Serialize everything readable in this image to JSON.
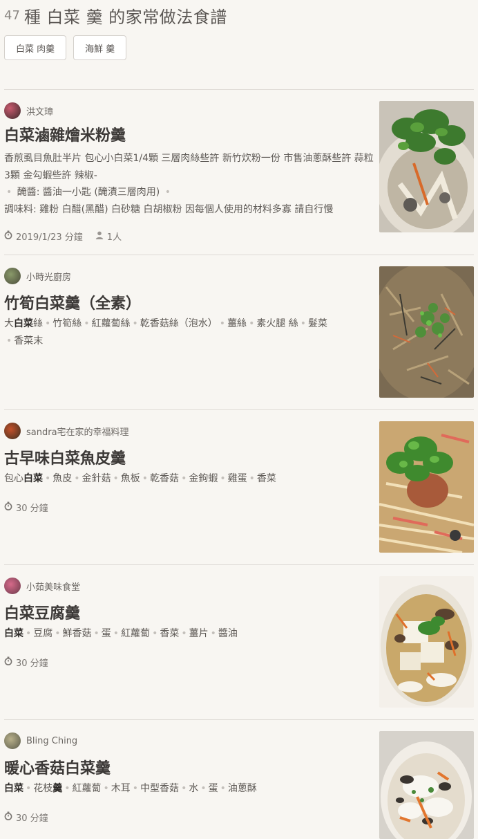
{
  "header": {
    "count": "47",
    "title": "種 白菜 羹 的家常做法食譜",
    "chips": [
      "白菜 肉羹",
      "海鮮 羹"
    ]
  },
  "recipes": [
    {
      "author": "洪文璋",
      "title": "白菜滷雜燴米粉羹",
      "ingredients": [
        "香煎虱目魚肚半片 包心小白菜1/4顆 三層肉絲些許 新竹炊粉一份 市售油蔥酥些許 蒜粒3顆 金勾蝦些許 辣椒-",
        "醃醬: 醬油一小匙 (醃漬三層肉用)",
        "調味料: 雞粉 白醋(黑醋) 白砂糖 白胡椒粉 因每個人使用的材料多寡 請自行慢"
      ],
      "date": "2019/1/23 分鐘",
      "servings": "1人"
    },
    {
      "author": "小時光廚房",
      "title": "竹筍白菜羹（全素）",
      "ingredients": [
        "大白菜絲",
        "竹筍絲",
        "紅蘿蔔絲",
        "乾香菇絲（泡水）",
        "薑絲",
        "素火腿 絲",
        "髮菜",
        "香菜末"
      ]
    },
    {
      "author": "sandra宅在家的幸福料理",
      "title": "古早味白菜魚皮羹",
      "ingredients": [
        "包心白菜",
        "魚皮",
        "金針菇",
        "魚板",
        "乾香菇",
        "金鉤蝦",
        "雞蛋",
        "香菜"
      ],
      "time": "30 分鐘"
    },
    {
      "author": "小茹美味食堂",
      "title": "白菜豆腐羹",
      "ingredients": [
        "白菜",
        "豆腐",
        "鮮香菇",
        "蛋",
        "紅蘿蔔",
        "香菜",
        "薑片",
        "醬油"
      ],
      "time": "30 分鐘"
    },
    {
      "author": "Bling Ching",
      "title": "暖心香菇白菜羹",
      "ingredients": [
        "白菜",
        "花枝羹",
        "紅蘿蔔",
        "木耳",
        "中型香菇",
        "水",
        "蛋",
        "油蔥酥"
      ],
      "time": "30 分鐘"
    }
  ],
  "icons": {
    "time": "stopwatch-icon",
    "servings": "person-icon"
  },
  "colors": {
    "background": "#f8f6f2",
    "title": "#3c3937",
    "accent_bold": "#2f2c2a"
  }
}
